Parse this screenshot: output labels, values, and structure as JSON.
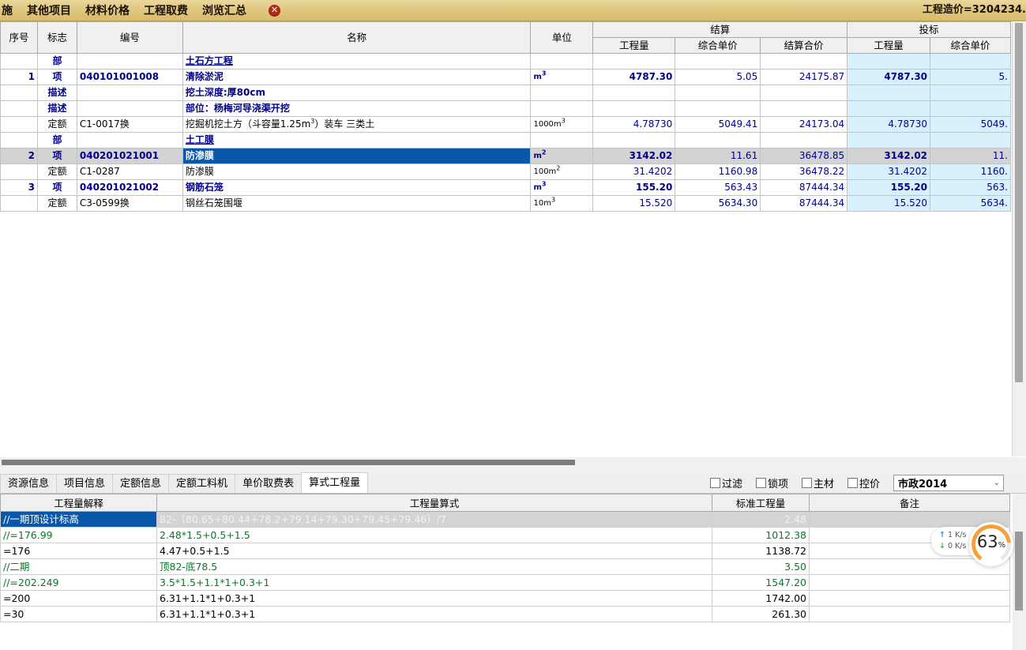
{
  "topbar": {
    "menu": [
      "施",
      "其他项目",
      "材料价格",
      "工程取费",
      "浏览汇总"
    ],
    "close_icon": "close-circle-icon",
    "total_label": "工程造价=3204234."
  },
  "upper_grid": {
    "group_headers": [
      {
        "label": "结算",
        "span": 3
      },
      {
        "label": "投标",
        "span": 2
      }
    ],
    "columns": [
      "序号",
      "标志",
      "编号",
      "名称",
      "单位",
      "工程量",
      "综合单价",
      "结算合价",
      "工程量",
      "综合单价"
    ],
    "rows": [
      {
        "no": "",
        "flag": "部",
        "code": "",
        "name": "土石方工程",
        "unit": "",
        "q1": "",
        "p1": "",
        "t1": "",
        "q2": "",
        "p2": "",
        "style": "part"
      },
      {
        "no": "1",
        "flag": "项",
        "code": "040101001008",
        "name": "清除淤泥",
        "unit": "m³",
        "q1": "4787.30",
        "p1": "5.05",
        "t1": "24175.87",
        "q2": "4787.30",
        "p2": "5.",
        "style": "item"
      },
      {
        "no": "",
        "flag": "描述",
        "code": "",
        "name": "挖土深度:厚80cm",
        "unit": "",
        "q1": "",
        "p1": "",
        "t1": "",
        "q2": "",
        "p2": "",
        "style": "desc"
      },
      {
        "no": "",
        "flag": "描述",
        "code": "",
        "name": "部位：杨梅河导浇渠开挖",
        "unit": "",
        "q1": "",
        "p1": "",
        "t1": "",
        "q2": "",
        "p2": "",
        "style": "desc"
      },
      {
        "no": "",
        "flag": "定额",
        "code": "C1-0017换",
        "name": "挖掘机挖土方（斗容量1.25m³）装车 三类土",
        "unit": "1000m³",
        "q1": "4.78730",
        "p1": "5049.41",
        "t1": "24173.04",
        "q2": "4.78730",
        "p2": "5049.",
        "style": "norm"
      },
      {
        "no": "",
        "flag": "部",
        "code": "",
        "name": "土工膜",
        "unit": "",
        "q1": "",
        "p1": "",
        "t1": "",
        "q2": "",
        "p2": "",
        "style": "part"
      },
      {
        "no": "2",
        "flag": "项",
        "code": "040201021001",
        "name": "防渗膜",
        "unit": "m²",
        "q1": "3142.02",
        "p1": "11.61",
        "t1": "36478.85",
        "q2": "3142.02",
        "p2": "11.",
        "style": "item-selected"
      },
      {
        "no": "",
        "flag": "定额",
        "code": "C1-0287",
        "name": "防渗膜",
        "unit": "100m²",
        "q1": "31.4202",
        "p1": "1160.98",
        "t1": "36478.22",
        "q2": "31.4202",
        "p2": "1160.",
        "style": "norm"
      },
      {
        "no": "3",
        "flag": "项",
        "code": "040201021002",
        "name": "钢筋石笼",
        "unit": "m³",
        "q1": "155.20",
        "p1": "563.43",
        "t1": "87444.34",
        "q2": "155.20",
        "p2": "563.",
        "style": "item"
      },
      {
        "no": "",
        "flag": "定额",
        "code": "C3-0599换",
        "name": "钢丝石笼围堰",
        "unit": "10m³",
        "q1": "15.520",
        "p1": "5634.30",
        "t1": "87444.34",
        "q2": "15.520",
        "p2": "5634.",
        "style": "norm"
      }
    ]
  },
  "tabstrip": {
    "tabs": [
      {
        "label": "资源信息",
        "active": false
      },
      {
        "label": "项目信息",
        "active": false
      },
      {
        "label": "定额信息",
        "active": false
      },
      {
        "label": "定额工料机",
        "active": false
      },
      {
        "label": "单价取费表",
        "active": false
      },
      {
        "label": "算式工程量",
        "active": true
      }
    ],
    "checkboxes": [
      {
        "label": "过滤",
        "checked": false
      },
      {
        "label": "锁项",
        "checked": false
      },
      {
        "label": "主材",
        "checked": false
      },
      {
        "label": "控价",
        "checked": false
      }
    ],
    "combo": {
      "value": "市政2014",
      "arrow": "chevron-down-icon"
    }
  },
  "lower_grid": {
    "columns": [
      "工程量解释",
      "工程量算式",
      "标准工程量",
      "备注"
    ],
    "rows": [
      {
        "explain": "//一期顶设计标高",
        "formula": "82-（80.65+80.44+78.2+79.14+79.30+79.45+79.46）/7",
        "qty": "2.48",
        "note": "",
        "style": "selected"
      },
      {
        "explain": "//=176.99",
        "formula": "2.48*1.5+0.5+1.5",
        "qty": "1012.38",
        "note": "",
        "style": "green"
      },
      {
        "explain": "=176",
        "formula": "4.47+0.5+1.5",
        "qty": "1138.72",
        "note": "",
        "style": "black"
      },
      {
        "explain": "//二期",
        "formula": "顶82-底78.5",
        "qty": "3.50",
        "note": "",
        "style": "green"
      },
      {
        "explain": "//=202.249",
        "formula": "3.5*1.5+1.1*1+0.3+1",
        "qty": "1547.20",
        "note": "",
        "style": "green"
      },
      {
        "explain": "=200",
        "formula": "6.31+1.1*1+0.3+1",
        "qty": "1742.00",
        "note": "",
        "style": "black"
      },
      {
        "explain": "=30",
        "formula": "6.31+1.1*1+0.3+1",
        "qty": "261.30",
        "note": "",
        "style": "black"
      }
    ]
  },
  "net_widget": {
    "upload": "1",
    "upload_unit": "K/s",
    "download": "0",
    "download_unit": "K/s",
    "percent": "63",
    "percent_symbol": "%",
    "up_icon": "arrow-up-icon",
    "down_icon": "arrow-down-icon"
  },
  "colors": {
    "topbar": "#ddc378",
    "selection": "#0a56a8",
    "data_blue": "#00008b",
    "tint": "#d8f0fb",
    "green": "#0a7a28",
    "accent_orange": "#f5a03c"
  }
}
